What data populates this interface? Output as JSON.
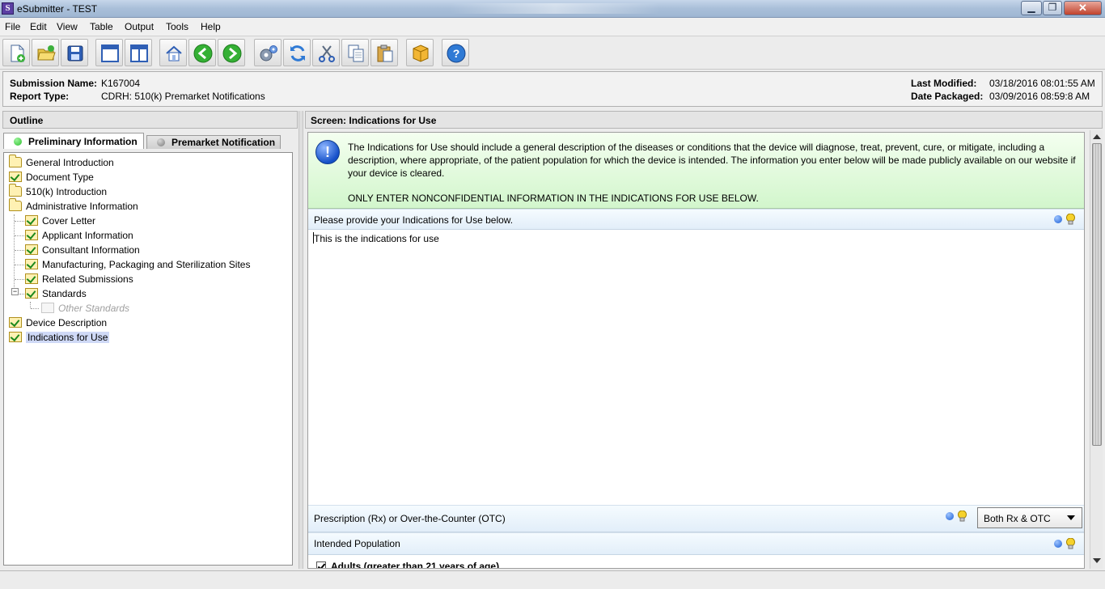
{
  "window": {
    "title": "eSubmitter - TEST",
    "app_icon_letter": "S"
  },
  "menu": [
    {
      "label": "File"
    },
    {
      "label": "Edit"
    },
    {
      "label": "View"
    },
    {
      "label": "Table"
    },
    {
      "label": "Output"
    },
    {
      "label": "Tools"
    },
    {
      "label": "Help"
    }
  ],
  "toolbar_icons": [
    "new-document-icon",
    "open-folder-icon",
    "save-disk-icon",
    "cascade-windows-icon",
    "split-panes-icon",
    "home-icon",
    "back-arrow-icon",
    "forward-arrow-icon",
    "settings-gears-icon",
    "refresh-icon",
    "cut-scissors-icon",
    "copy-icon",
    "paste-icon",
    "package-icon",
    "help-icon"
  ],
  "info": {
    "submission_name_label": "Submission Name:",
    "submission_name": "K167004",
    "report_type_label": "Report Type:",
    "report_type": "CDRH: 510(k) Premarket Notifications",
    "last_modified_label": "Last Modified:",
    "last_modified": "03/18/2016 08:01:55 AM",
    "date_packaged_label": "Date Packaged:",
    "date_packaged": "03/09/2016 08:59:8 AM"
  },
  "outline": {
    "header": "Outline",
    "tabs": [
      {
        "label": "Preliminary Information",
        "active": true,
        "dot_color": "#2fbf2f"
      },
      {
        "label": "Premarket Notification",
        "active": false,
        "dot_color": "#8a8a8a"
      }
    ],
    "tree": [
      {
        "label": "General Introduction",
        "icon": "folder-icon"
      },
      {
        "label": "Document Type",
        "icon": "checked-folder-icon"
      },
      {
        "label": "510(k) Introduction",
        "icon": "folder-icon"
      },
      {
        "label": "Administrative Information",
        "icon": "folder-icon"
      },
      {
        "label": "Cover Letter",
        "icon": "checked-folder-icon"
      },
      {
        "label": "Applicant Information",
        "icon": "checked-folder-icon"
      },
      {
        "label": "Consultant Information",
        "icon": "checked-folder-icon"
      },
      {
        "label": "Manufacturing, Packaging and Sterilization Sites",
        "icon": "checked-folder-icon"
      },
      {
        "label": "Related Submissions",
        "icon": "checked-folder-icon"
      },
      {
        "label": "Standards",
        "icon": "checked-folder-icon"
      },
      {
        "label": "Other Standards",
        "icon": "disabled-folder-icon"
      },
      {
        "label": "Device Description",
        "icon": "checked-folder-icon"
      },
      {
        "label": "Indications for Use",
        "icon": "checked-folder-icon",
        "selected": true
      }
    ]
  },
  "screen": {
    "header": "Screen: Indications for Use",
    "notice": "The Indications for Use should include a general description of the diseases or conditions that the device will diagnose, treat, prevent, cure, or mitigate, including a description, where appropriate, of the patient population for which the device is intended. The information you enter below will be made publicly available on our website if your device is cleared.",
    "notice_warning": "ONLY ENTER NONCONFIDENTIAL INFORMATION IN THE INDICATIONS FOR USE BELOW.",
    "ifu_prompt": "Please provide your Indications for Use below.",
    "ifu_value": "This is the indications for use",
    "rx_label": "Prescription (Rx) or Over-the-Counter (OTC)",
    "rx_value": "Both Rx & OTC",
    "population_label": "Intended Population",
    "adults_label": "Adults (greater than 21 years of age)"
  },
  "colors": {
    "notice_bg": "#d2f6cc",
    "selected_bg": "#cfd9f6",
    "check_green": "#1d8a1d",
    "info_blue": "#1550c8"
  }
}
